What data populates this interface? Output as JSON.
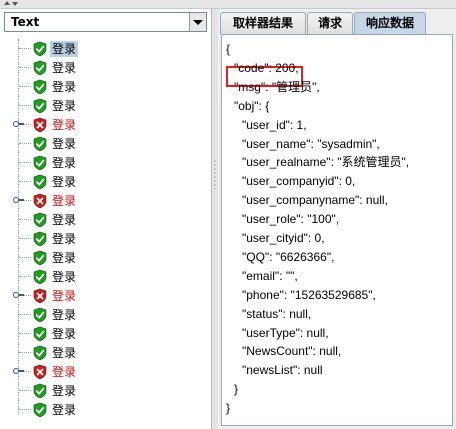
{
  "combo": {
    "selected": "Text"
  },
  "tree": {
    "items": [
      {
        "label": "登录",
        "status": "success",
        "selected": true
      },
      {
        "label": "登录",
        "status": "success"
      },
      {
        "label": "登录",
        "status": "success"
      },
      {
        "label": "登录",
        "status": "success"
      },
      {
        "label": "登录",
        "status": "failure"
      },
      {
        "label": "登录",
        "status": "success"
      },
      {
        "label": "登录",
        "status": "success"
      },
      {
        "label": "登录",
        "status": "success"
      },
      {
        "label": "登录",
        "status": "failure"
      },
      {
        "label": "登录",
        "status": "success"
      },
      {
        "label": "登录",
        "status": "success"
      },
      {
        "label": "登录",
        "status": "success"
      },
      {
        "label": "登录",
        "status": "success"
      },
      {
        "label": "登录",
        "status": "failure"
      },
      {
        "label": "登录",
        "status": "success"
      },
      {
        "label": "登录",
        "status": "success"
      },
      {
        "label": "登录",
        "status": "success"
      },
      {
        "label": "登录",
        "status": "failure"
      },
      {
        "label": "登录",
        "status": "success"
      },
      {
        "label": "登录",
        "status": "success"
      }
    ]
  },
  "tabs": [
    {
      "label": "取样器结果"
    },
    {
      "label": "请求"
    },
    {
      "label": "响应数据",
      "active": true
    }
  ],
  "response": {
    "lines": [
      "{",
      "  \"code\": 200,",
      "  \"msg\": \"管理员\",",
      "  \"obj\": {",
      "    \"user_id\": 1,",
      "    \"user_name\": \"sysadmin\",",
      "    \"user_realname\": \"系统管理员\",",
      "    \"user_companyid\": 0,",
      "    \"user_companyname\": null,",
      "    \"user_role\": \"100\",",
      "    \"user_cityid\": 0,",
      "    \"QQ\": \"6626366\",",
      "    \"email\": \"\",",
      "    \"phone\": \"15263529685\",",
      "    \"status\": null,",
      "    \"userType\": null,",
      "    \"NewsCount\": null,",
      "    \"newsList\": null",
      "  }",
      "}"
    ]
  },
  "colors": {
    "success": "#1aa01a",
    "failure": "#d11a1a",
    "highlight": "#e02020"
  }
}
